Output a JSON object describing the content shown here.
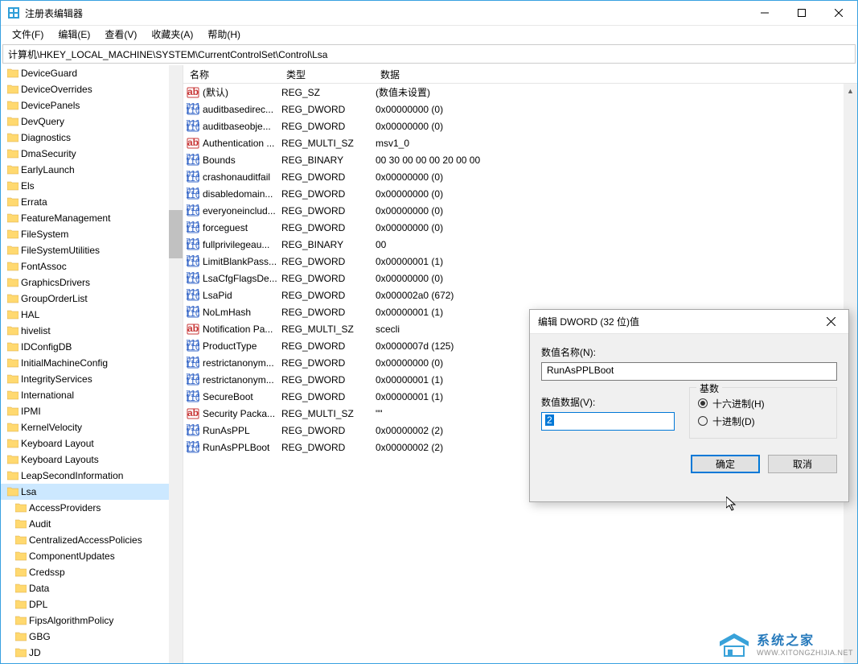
{
  "window": {
    "title": "注册表编辑器"
  },
  "menu": {
    "file": "文件(F)",
    "edit": "编辑(E)",
    "view": "查看(V)",
    "fav": "收藏夹(A)",
    "help": "帮助(H)"
  },
  "address": "计算机\\HKEY_LOCAL_MACHINE\\SYSTEM\\CurrentControlSet\\Control\\Lsa",
  "headers": {
    "name": "名称",
    "type": "类型",
    "data": "数据"
  },
  "tree": [
    {
      "label": "DeviceGuard",
      "sub": false
    },
    {
      "label": "DeviceOverrides",
      "sub": false
    },
    {
      "label": "DevicePanels",
      "sub": false
    },
    {
      "label": "DevQuery",
      "sub": false
    },
    {
      "label": "Diagnostics",
      "sub": false
    },
    {
      "label": "DmaSecurity",
      "sub": false
    },
    {
      "label": "EarlyLaunch",
      "sub": false
    },
    {
      "label": "Els",
      "sub": false
    },
    {
      "label": "Errata",
      "sub": false
    },
    {
      "label": "FeatureManagement",
      "sub": false
    },
    {
      "label": "FileSystem",
      "sub": false
    },
    {
      "label": "FileSystemUtilities",
      "sub": false
    },
    {
      "label": "FontAssoc",
      "sub": false
    },
    {
      "label": "GraphicsDrivers",
      "sub": false
    },
    {
      "label": "GroupOrderList",
      "sub": false
    },
    {
      "label": "HAL",
      "sub": false
    },
    {
      "label": "hivelist",
      "sub": false
    },
    {
      "label": "IDConfigDB",
      "sub": false
    },
    {
      "label": "InitialMachineConfig",
      "sub": false
    },
    {
      "label": "IntegrityServices",
      "sub": false
    },
    {
      "label": "International",
      "sub": false
    },
    {
      "label": "IPMI",
      "sub": false
    },
    {
      "label": "KernelVelocity",
      "sub": false
    },
    {
      "label": "Keyboard Layout",
      "sub": false
    },
    {
      "label": "Keyboard Layouts",
      "sub": false
    },
    {
      "label": "LeapSecondInformation",
      "sub": false
    },
    {
      "label": "Lsa",
      "sub": false,
      "sel": true
    },
    {
      "label": "AccessProviders",
      "sub": true
    },
    {
      "label": "Audit",
      "sub": true
    },
    {
      "label": "CentralizedAccessPolicies",
      "sub": true
    },
    {
      "label": "ComponentUpdates",
      "sub": true
    },
    {
      "label": "Credssp",
      "sub": true
    },
    {
      "label": "Data",
      "sub": true
    },
    {
      "label": "DPL",
      "sub": true
    },
    {
      "label": "FipsAlgorithmPolicy",
      "sub": true
    },
    {
      "label": "GBG",
      "sub": true
    },
    {
      "label": "JD",
      "sub": true
    }
  ],
  "values": [
    {
      "icon": "sz",
      "name": "(默认)",
      "type": "REG_SZ",
      "data": "(数值未设置)"
    },
    {
      "icon": "bin",
      "name": "auditbasedirec...",
      "type": "REG_DWORD",
      "data": "0x00000000 (0)"
    },
    {
      "icon": "bin",
      "name": "auditbaseobje...",
      "type": "REG_DWORD",
      "data": "0x00000000 (0)"
    },
    {
      "icon": "sz",
      "name": "Authentication ...",
      "type": "REG_MULTI_SZ",
      "data": "msv1_0"
    },
    {
      "icon": "bin",
      "name": "Bounds",
      "type": "REG_BINARY",
      "data": "00 30 00 00 00 20 00 00"
    },
    {
      "icon": "bin",
      "name": "crashonauditfail",
      "type": "REG_DWORD",
      "data": "0x00000000 (0)"
    },
    {
      "icon": "bin",
      "name": "disabledomain...",
      "type": "REG_DWORD",
      "data": "0x00000000 (0)"
    },
    {
      "icon": "bin",
      "name": "everyoneinclud...",
      "type": "REG_DWORD",
      "data": "0x00000000 (0)"
    },
    {
      "icon": "bin",
      "name": "forceguest",
      "type": "REG_DWORD",
      "data": "0x00000000 (0)"
    },
    {
      "icon": "bin",
      "name": "fullprivilegeau...",
      "type": "REG_BINARY",
      "data": "00"
    },
    {
      "icon": "bin",
      "name": "LimitBlankPass...",
      "type": "REG_DWORD",
      "data": "0x00000001 (1)"
    },
    {
      "icon": "bin",
      "name": "LsaCfgFlagsDe...",
      "type": "REG_DWORD",
      "data": "0x00000000 (0)"
    },
    {
      "icon": "bin",
      "name": "LsaPid",
      "type": "REG_DWORD",
      "data": "0x000002a0 (672)"
    },
    {
      "icon": "bin",
      "name": "NoLmHash",
      "type": "REG_DWORD",
      "data": "0x00000001 (1)"
    },
    {
      "icon": "sz",
      "name": "Notification Pa...",
      "type": "REG_MULTI_SZ",
      "data": "scecli"
    },
    {
      "icon": "bin",
      "name": "ProductType",
      "type": "REG_DWORD",
      "data": "0x0000007d (125)"
    },
    {
      "icon": "bin",
      "name": "restrictanonym...",
      "type": "REG_DWORD",
      "data": "0x00000000 (0)"
    },
    {
      "icon": "bin",
      "name": "restrictanonym...",
      "type": "REG_DWORD",
      "data": "0x00000001 (1)"
    },
    {
      "icon": "bin",
      "name": "SecureBoot",
      "type": "REG_DWORD",
      "data": "0x00000001 (1)"
    },
    {
      "icon": "sz",
      "name": "Security Packa...",
      "type": "REG_MULTI_SZ",
      "data": "\"\""
    },
    {
      "icon": "bin",
      "name": "RunAsPPL",
      "type": "REG_DWORD",
      "data": "0x00000002 (2)"
    },
    {
      "icon": "bin",
      "name": "RunAsPPLBoot",
      "type": "REG_DWORD",
      "data": "0x00000002 (2)"
    }
  ],
  "dialog": {
    "title": "编辑 DWORD (32 位)值",
    "name_label": "数值名称(N):",
    "name_value": "RunAsPPLBoot",
    "data_label": "数值数据(V):",
    "data_value": "2",
    "base_label": "基数",
    "hex": "十六进制(H)",
    "dec": "十进制(D)",
    "ok": "确定",
    "cancel": "取消"
  },
  "watermark": {
    "line1": "系统之家",
    "line2": "WWW.XITONGZHIJIA.NET"
  }
}
